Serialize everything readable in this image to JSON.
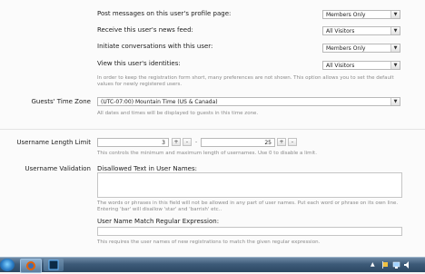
{
  "privacy": {
    "rows": [
      {
        "label": "Post messages on this user's profile page:",
        "value": "Members Only"
      },
      {
        "label": "Receive this user's news feed:",
        "value": "All Visitors"
      },
      {
        "label": "Initiate conversations with this user:",
        "value": "Members Only"
      },
      {
        "label": "View this user's identities:",
        "value": "All Visitors"
      }
    ],
    "note_line1": "In order to keep the registration form short, many preferences are not shown. This option allows you to set the default",
    "note_line2": "values for newly registered users."
  },
  "timezone": {
    "label": "Guests' Time Zone",
    "value": "(UTC-07:00) Mountain Time (US & Canada)",
    "hint": "All dates and times will be displayed to guests in this time zone."
  },
  "username_length": {
    "label": "Username Length Limit",
    "min": "3",
    "max": "25",
    "separator": "-",
    "plus": "+",
    "minus": "-",
    "hint": "This controls the minimum and maximum length of usernames. Use 0 to disable a limit."
  },
  "username_validation": {
    "label": "Username Validation",
    "disallowed_label": "Disallowed Text in User Names:",
    "disallowed_hint1": "The words or phrases in this field will not be allowed in any part of user names. Put each word or phrase on its own line.",
    "disallowed_hint2": "Entering 'bar' will disallow 'star' and 'barrish' etc..",
    "regex_label": "User Name Match Regular Expression:",
    "regex_hint": "This requires the user names of new registrations to match the given regular expression."
  },
  "taskbar": {
    "icons": [
      "start-orb-icon",
      "firefox-icon",
      "photoshop-icon"
    ],
    "tray_icons": [
      "arrow-up-icon",
      "flag-icon",
      "network-icon",
      "volume-icon"
    ]
  }
}
